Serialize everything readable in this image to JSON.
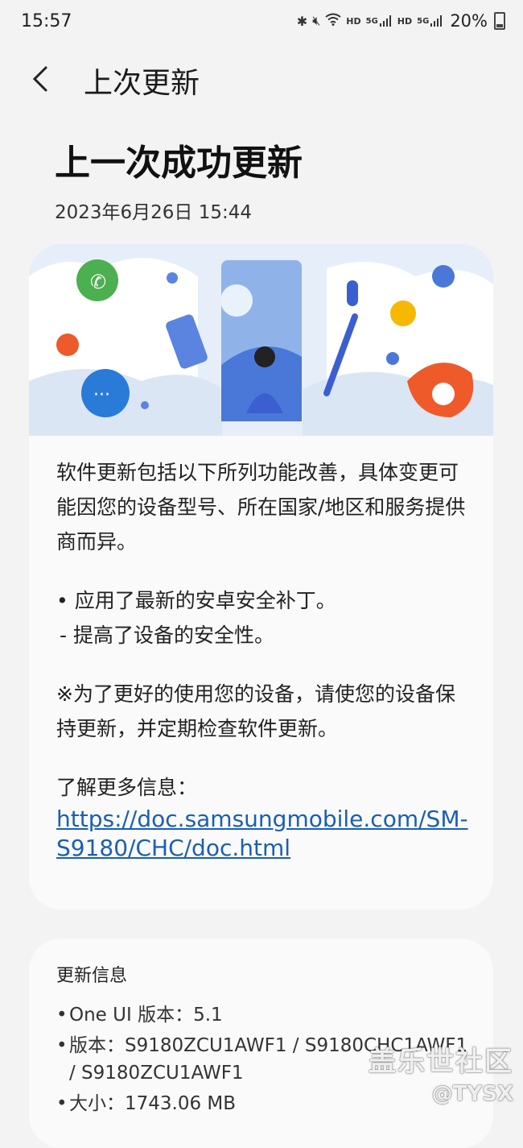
{
  "status_bar": {
    "time": "15:57",
    "hd1": "HD",
    "net1": "5G",
    "hd2": "HD",
    "net2": "5G",
    "battery": "20%"
  },
  "header": {
    "title": "上次更新",
    "back_icon": "chevron-left-icon"
  },
  "summary": {
    "headline": "上一次成功更新",
    "date": "2023年6月26日 15:44"
  },
  "release_notes": {
    "intro": "软件更新包括以下所列功能改善，具体变更可能因您的设备型号、所在国家/地区和服务提供商而异。",
    "bullet": "• 应用了最新的安卓安全补丁。",
    "sub_bullet": "- 提高了设备的安全性。",
    "note": "※为了更好的使用您的设备，请使您的设备保持更新，并定期检查软件更新。",
    "more_info_label": "了解更多信息：",
    "more_info_link": "https://doc.samsungmobile.com/SM-S9180/CHC/doc.html"
  },
  "update_info": {
    "title": "更新信息",
    "rows": [
      {
        "bullet": "•",
        "text": "One UI 版本：5.1"
      },
      {
        "bullet": "•",
        "text": "版本：S9180ZCU1AWF1 / S9180CHC1AWF1 / S9180ZCU1AWF1"
      },
      {
        "bullet": "•",
        "text": "大小：1743.06 MB"
      }
    ]
  },
  "watermark": {
    "line1": "盖乐世社区",
    "line2": "@TYSX"
  },
  "colors": {
    "background": "#f3f3f3",
    "card": "#fafafa",
    "link": "#1a5fb4",
    "hero_sky": "#e8f0fa"
  }
}
